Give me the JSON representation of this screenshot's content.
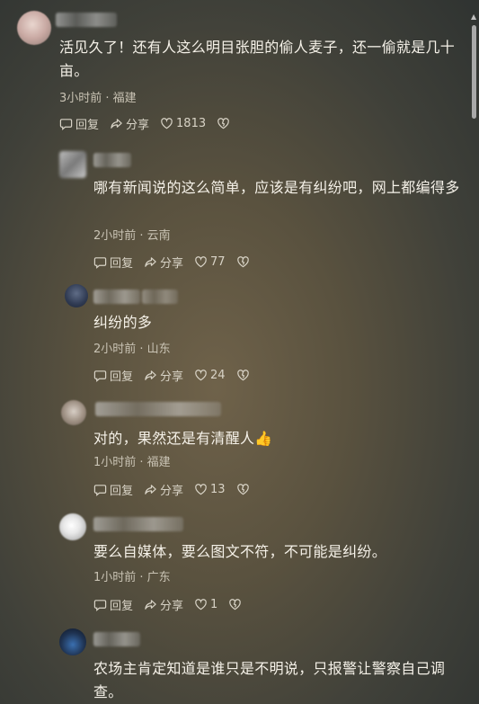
{
  "comments": [
    {
      "text": "活见久了！还有人这么明目张胆的偷人麦子，还一偷就是几十亩。",
      "time": "3小时前",
      "location": "福建",
      "meta": "3小时前 · 福建",
      "reply_label": "回复",
      "share_label": "分享",
      "likes": "1813"
    },
    {
      "text": "哪有新闻说的这么简单，应该是有纠纷吧，网上都编得多",
      "time": "2小时前",
      "location": "云南",
      "meta": "2小时前 · 云南",
      "reply_label": "回复",
      "share_label": "分享",
      "likes": "77"
    },
    {
      "text": "纠纷的多",
      "time": "2小时前",
      "location": "山东",
      "meta": "2小时前 · 山东",
      "reply_label": "回复",
      "share_label": "分享",
      "likes": "24"
    },
    {
      "text": "对的，果然还是有清醒人",
      "emoji": "👍",
      "time": "1小时前",
      "location": "福建",
      "meta": "1小时前 · 福建",
      "reply_label": "回复",
      "share_label": "分享",
      "likes": "13"
    },
    {
      "text": "要么自媒体，要么图文不符，不可能是纠纷。",
      "time": "1小时前",
      "location": "广东",
      "meta": "1小时前 · 广东",
      "reply_label": "回复",
      "share_label": "分享",
      "likes": "1"
    },
    {
      "text": "农场主肯定知道是谁只是不明说，只报警让警察自己调查。"
    }
  ],
  "colors": {
    "text": "#f5f1e8",
    "meta": "#c9c3b4",
    "action": "#d8d3c6"
  },
  "icons": {
    "reply": "reply-icon",
    "share": "share-icon",
    "like": "heart-icon",
    "dislike": "broken-heart-icon"
  }
}
